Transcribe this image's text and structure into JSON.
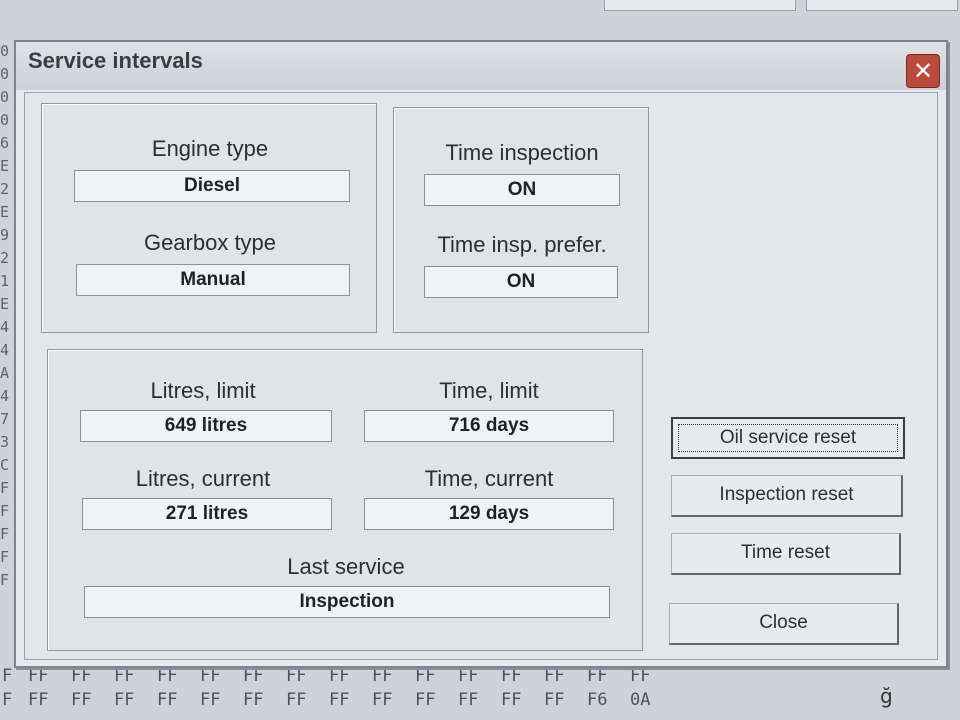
{
  "background": {
    "left_chars": [
      "0",
      "0",
      "0",
      "0",
      "6",
      "E",
      "2",
      "E",
      "9",
      "2",
      "1",
      "E",
      "4",
      "4",
      "A",
      "4",
      "7",
      "3",
      "C",
      "F",
      "F",
      "F",
      "F",
      "F"
    ],
    "hex_row_1": [
      "F",
      "FF",
      "FF",
      "FF",
      "FF",
      "FF",
      "FF",
      "FF",
      "FF",
      "FF",
      "FF",
      "FF",
      "FF",
      "FF",
      "FF",
      "FF"
    ],
    "hex_row_2": [
      "F",
      "FF",
      "FF",
      "FF",
      "FF",
      "FF",
      "FF",
      "FF",
      "FF",
      "FF",
      "FF",
      "FF",
      "FF",
      "FF",
      "F6",
      "0A"
    ],
    "stray_glyph": "ğ"
  },
  "dialog": {
    "title": "Service intervals",
    "close_glyph": "✕",
    "engine": {
      "label": "Engine type",
      "value": "Diesel"
    },
    "gearbox": {
      "label": "Gearbox type",
      "value": "Manual"
    },
    "time_inspection": {
      "label": "Time inspection",
      "value": "ON"
    },
    "time_insp_prefer": {
      "label": "Time insp. prefer.",
      "value": "ON"
    },
    "litres_limit": {
      "label": "Litres, limit",
      "value": "649 litres"
    },
    "time_limit": {
      "label": "Time, limit",
      "value": "716 days"
    },
    "litres_current": {
      "label": "Litres, current",
      "value": "271 litres"
    },
    "time_current": {
      "label": "Time, current",
      "value": "129 days"
    },
    "last_service": {
      "label": "Last service",
      "value": "Inspection"
    },
    "buttons": {
      "oil_reset": "Oil service reset",
      "inspection_reset": "Inspection reset",
      "time_reset": "Time reset",
      "close": "Close"
    }
  }
}
